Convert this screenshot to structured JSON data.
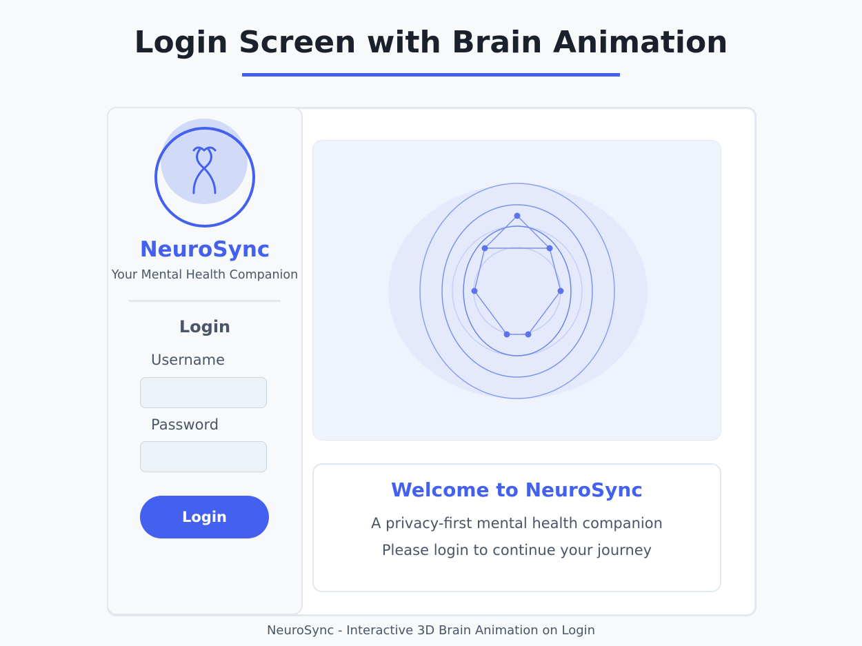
{
  "page": {
    "title": "Login Screen with Brain Animation",
    "footer_caption": "NeuroSync - Interactive 3D Brain Animation on Login"
  },
  "sidebar": {
    "logo_icon": "figure-icon",
    "brand_name": "NeuroSync",
    "tagline": "Your Mental Health Companion",
    "login_heading": "Login",
    "username_label": "Username",
    "username_value": "",
    "password_label": "Password",
    "password_value": "",
    "login_button_label": "Login"
  },
  "welcome": {
    "title": "Welcome to NeuroSync",
    "line1": "A privacy-first mental health companion",
    "line2": "Please login to continue your journey"
  },
  "colors": {
    "accent": "#4361ee",
    "accent_light": "#d1daf7",
    "text_dark": "#1a202c",
    "text_muted": "#4a5568",
    "border": "#e2e8f0",
    "input_bg": "#edf2f7"
  }
}
